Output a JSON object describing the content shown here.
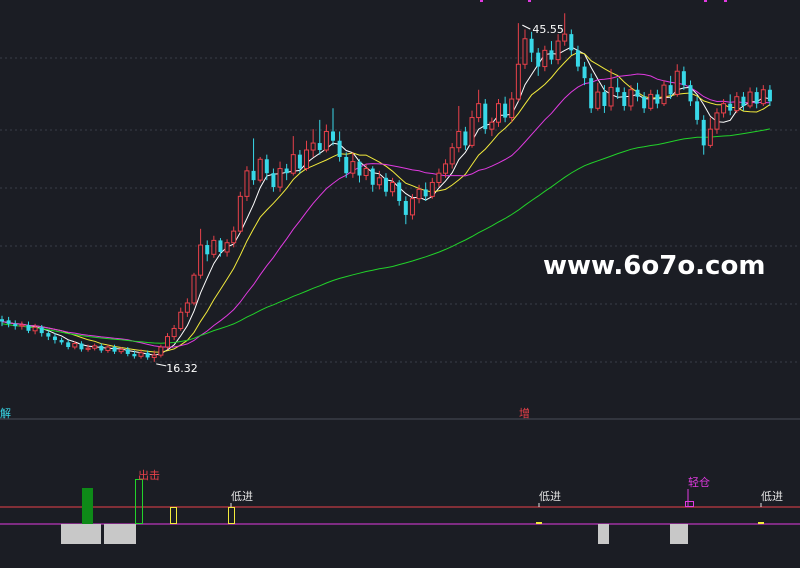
{
  "watermark": "www.6o7o.com",
  "chart_data": {
    "type": "candlestick",
    "colors": {
      "up": "#e8414a",
      "down": "#38d8e8",
      "background": "#1b1d24",
      "grid": "#3a3d48"
    },
    "annotations": {
      "high_label": "45.55",
      "low_label": "16.32",
      "high_value": 45.55,
      "low_value": 16.32
    },
    "price_range": [
      13.2,
      47.2
    ],
    "candles": [
      {
        "o": 20.0,
        "c": 19.8,
        "h": 20.3,
        "l": 19.4
      },
      {
        "o": 19.9,
        "c": 19.6,
        "h": 20.2,
        "l": 19.3
      },
      {
        "o": 19.6,
        "c": 19.4,
        "h": 19.9,
        "l": 19.1
      },
      {
        "o": 19.4,
        "c": 19.5,
        "h": 19.8,
        "l": 19.1
      },
      {
        "o": 19.5,
        "c": 19.0,
        "h": 19.8,
        "l": 18.8
      },
      {
        "o": 19.0,
        "c": 19.3,
        "h": 19.6,
        "l": 18.7
      },
      {
        "o": 19.3,
        "c": 18.8,
        "h": 19.5,
        "l": 18.5
      },
      {
        "o": 18.8,
        "c": 18.5,
        "h": 19.0,
        "l": 18.2
      },
      {
        "o": 18.5,
        "c": 18.2,
        "h": 18.8,
        "l": 17.9
      },
      {
        "o": 18.2,
        "c": 18.0,
        "h": 18.4,
        "l": 17.8
      },
      {
        "o": 18.0,
        "c": 17.6,
        "h": 18.2,
        "l": 17.4
      },
      {
        "o": 17.6,
        "c": 17.9,
        "h": 18.1,
        "l": 17.4
      },
      {
        "o": 17.9,
        "c": 17.4,
        "h": 18.1,
        "l": 17.2
      },
      {
        "o": 17.4,
        "c": 17.5,
        "h": 17.8,
        "l": 17.2
      },
      {
        "o": 17.5,
        "c": 17.7,
        "h": 17.9,
        "l": 17.3
      },
      {
        "o": 17.7,
        "c": 17.3,
        "h": 17.9,
        "l": 17.1
      },
      {
        "o": 17.3,
        "c": 17.6,
        "h": 17.8,
        "l": 17.1
      },
      {
        "o": 17.6,
        "c": 17.2,
        "h": 17.8,
        "l": 17.0
      },
      {
        "o": 17.2,
        "c": 17.4,
        "h": 17.6,
        "l": 17.0
      },
      {
        "o": 17.4,
        "c": 17.0,
        "h": 17.6,
        "l": 16.8
      },
      {
        "o": 17.0,
        "c": 16.8,
        "h": 17.3,
        "l": 16.6
      },
      {
        "o": 16.8,
        "c": 17.1,
        "h": 17.4,
        "l": 16.6
      },
      {
        "o": 17.1,
        "c": 16.7,
        "h": 17.3,
        "l": 16.5
      },
      {
        "o": 16.7,
        "c": 16.9,
        "h": 17.3,
        "l": 16.32
      },
      {
        "o": 16.9,
        "c": 17.6,
        "h": 17.8,
        "l": 16.7
      },
      {
        "o": 17.6,
        "c": 18.5,
        "h": 18.8,
        "l": 17.4
      },
      {
        "o": 18.5,
        "c": 19.2,
        "h": 19.5,
        "l": 18.2
      },
      {
        "o": 19.2,
        "c": 20.6,
        "h": 21.0,
        "l": 19.0
      },
      {
        "o": 20.6,
        "c": 21.4,
        "h": 21.8,
        "l": 20.2
      },
      {
        "o": 21.4,
        "c": 23.8,
        "h": 24.0,
        "l": 21.2
      },
      {
        "o": 23.8,
        "c": 26.4,
        "h": 27.8,
        "l": 23.5
      },
      {
        "o": 26.4,
        "c": 25.6,
        "h": 26.8,
        "l": 25.0
      },
      {
        "o": 25.6,
        "c": 26.8,
        "h": 27.2,
        "l": 25.3
      },
      {
        "o": 26.8,
        "c": 25.8,
        "h": 27.0,
        "l": 25.4
      },
      {
        "o": 25.8,
        "c": 26.6,
        "h": 26.9,
        "l": 25.4
      },
      {
        "o": 26.6,
        "c": 27.6,
        "h": 28.0,
        "l": 26.2
      },
      {
        "o": 27.6,
        "c": 30.6,
        "h": 31.0,
        "l": 27.4
      },
      {
        "o": 30.6,
        "c": 32.8,
        "h": 33.2,
        "l": 30.2
      },
      {
        "o": 32.8,
        "c": 32.0,
        "h": 35.6,
        "l": 31.6
      },
      {
        "o": 32.0,
        "c": 33.8,
        "h": 34.0,
        "l": 31.8
      },
      {
        "o": 33.8,
        "c": 32.6,
        "h": 34.2,
        "l": 32.0
      },
      {
        "o": 32.6,
        "c": 31.4,
        "h": 33.0,
        "l": 31.0
      },
      {
        "o": 31.4,
        "c": 33.0,
        "h": 33.6,
        "l": 31.0
      },
      {
        "o": 33.0,
        "c": 32.6,
        "h": 33.4,
        "l": 32.0
      },
      {
        "o": 32.6,
        "c": 34.2,
        "h": 35.8,
        "l": 32.4
      },
      {
        "o": 34.2,
        "c": 33.0,
        "h": 34.6,
        "l": 32.6
      },
      {
        "o": 33.0,
        "c": 34.6,
        "h": 35.4,
        "l": 32.8
      },
      {
        "o": 34.6,
        "c": 35.2,
        "h": 36.4,
        "l": 34.0
      },
      {
        "o": 35.2,
        "c": 34.6,
        "h": 37.2,
        "l": 34.2
      },
      {
        "o": 34.6,
        "c": 36.2,
        "h": 36.8,
        "l": 34.4
      },
      {
        "o": 36.2,
        "c": 35.4,
        "h": 38.2,
        "l": 35.0
      },
      {
        "o": 35.4,
        "c": 34.0,
        "h": 36.2,
        "l": 33.6
      },
      {
        "o": 34.0,
        "c": 32.6,
        "h": 34.4,
        "l": 32.2
      },
      {
        "o": 32.6,
        "c": 33.6,
        "h": 34.4,
        "l": 32.2
      },
      {
        "o": 33.6,
        "c": 32.4,
        "h": 33.8,
        "l": 31.8
      },
      {
        "o": 32.4,
        "c": 33.0,
        "h": 33.4,
        "l": 32.0
      },
      {
        "o": 33.0,
        "c": 31.6,
        "h": 33.2,
        "l": 31.0
      },
      {
        "o": 31.6,
        "c": 32.2,
        "h": 32.8,
        "l": 31.2
      },
      {
        "o": 32.2,
        "c": 31.0,
        "h": 32.6,
        "l": 30.6
      },
      {
        "o": 31.0,
        "c": 31.8,
        "h": 32.2,
        "l": 30.6
      },
      {
        "o": 31.8,
        "c": 30.2,
        "h": 32.0,
        "l": 29.8
      },
      {
        "o": 30.2,
        "c": 29.0,
        "h": 30.6,
        "l": 28.2
      },
      {
        "o": 29.0,
        "c": 30.4,
        "h": 30.8,
        "l": 28.6
      },
      {
        "o": 30.4,
        "c": 31.2,
        "h": 31.6,
        "l": 30.0
      },
      {
        "o": 31.2,
        "c": 30.6,
        "h": 31.8,
        "l": 30.2
      },
      {
        "o": 30.6,
        "c": 31.8,
        "h": 32.2,
        "l": 30.4
      },
      {
        "o": 31.8,
        "c": 32.6,
        "h": 33.0,
        "l": 31.4
      },
      {
        "o": 32.6,
        "c": 33.4,
        "h": 33.8,
        "l": 32.2
      },
      {
        "o": 33.4,
        "c": 34.8,
        "h": 35.2,
        "l": 33.0
      },
      {
        "o": 34.8,
        "c": 36.2,
        "h": 38.4,
        "l": 34.4
      },
      {
        "o": 36.2,
        "c": 35.0,
        "h": 36.6,
        "l": 34.6
      },
      {
        "o": 35.0,
        "c": 37.4,
        "h": 38.0,
        "l": 34.8
      },
      {
        "o": 37.4,
        "c": 38.6,
        "h": 39.8,
        "l": 37.0
      },
      {
        "o": 38.6,
        "c": 36.4,
        "h": 39.0,
        "l": 36.0
      },
      {
        "o": 36.4,
        "c": 37.0,
        "h": 37.4,
        "l": 35.8
      },
      {
        "o": 37.0,
        "c": 38.6,
        "h": 39.0,
        "l": 36.6
      },
      {
        "o": 38.6,
        "c": 37.4,
        "h": 39.2,
        "l": 37.0
      },
      {
        "o": 37.4,
        "c": 39.0,
        "h": 39.6,
        "l": 37.0
      },
      {
        "o": 39.0,
        "c": 42.0,
        "h": 45.55,
        "l": 38.8
      },
      {
        "o": 42.0,
        "c": 44.2,
        "h": 45.0,
        "l": 41.6
      },
      {
        "o": 44.2,
        "c": 43.0,
        "h": 44.8,
        "l": 42.2
      },
      {
        "o": 43.0,
        "c": 41.8,
        "h": 43.4,
        "l": 41.0
      },
      {
        "o": 41.8,
        "c": 43.2,
        "h": 43.6,
        "l": 41.4
      },
      {
        "o": 43.2,
        "c": 42.4,
        "h": 44.0,
        "l": 42.0
      },
      {
        "o": 42.4,
        "c": 44.0,
        "h": 44.6,
        "l": 42.0
      },
      {
        "o": 44.0,
        "c": 44.6,
        "h": 46.4,
        "l": 43.6
      },
      {
        "o": 44.6,
        "c": 43.2,
        "h": 45.0,
        "l": 42.8
      },
      {
        "o": 43.2,
        "c": 41.8,
        "h": 43.6,
        "l": 41.4
      },
      {
        "o": 41.8,
        "c": 40.8,
        "h": 42.2,
        "l": 40.2
      },
      {
        "o": 40.8,
        "c": 38.2,
        "h": 41.2,
        "l": 37.8
      },
      {
        "o": 38.2,
        "c": 39.6,
        "h": 40.4,
        "l": 38.0
      },
      {
        "o": 39.6,
        "c": 38.4,
        "h": 40.2,
        "l": 37.8
      },
      {
        "o": 38.4,
        "c": 40.0,
        "h": 41.6,
        "l": 38.0
      },
      {
        "o": 40.0,
        "c": 39.6,
        "h": 40.8,
        "l": 39.0
      },
      {
        "o": 39.6,
        "c": 38.4,
        "h": 40.0,
        "l": 38.0
      },
      {
        "o": 38.4,
        "c": 39.8,
        "h": 40.2,
        "l": 38.0
      },
      {
        "o": 39.8,
        "c": 39.2,
        "h": 40.4,
        "l": 38.8
      },
      {
        "o": 39.2,
        "c": 38.2,
        "h": 39.6,
        "l": 37.8
      },
      {
        "o": 38.2,
        "c": 39.4,
        "h": 39.8,
        "l": 38.0
      },
      {
        "o": 39.4,
        "c": 38.6,
        "h": 39.8,
        "l": 38.2
      },
      {
        "o": 38.6,
        "c": 40.2,
        "h": 40.6,
        "l": 38.4
      },
      {
        "o": 40.2,
        "c": 39.4,
        "h": 41.0,
        "l": 39.0
      },
      {
        "o": 39.4,
        "c": 41.4,
        "h": 42.0,
        "l": 39.2
      },
      {
        "o": 41.4,
        "c": 40.2,
        "h": 41.8,
        "l": 39.8
      },
      {
        "o": 40.2,
        "c": 38.8,
        "h": 40.6,
        "l": 38.4
      },
      {
        "o": 38.8,
        "c": 37.2,
        "h": 39.2,
        "l": 36.8
      },
      {
        "o": 37.2,
        "c": 35.0,
        "h": 37.6,
        "l": 34.2
      },
      {
        "o": 35.0,
        "c": 36.4,
        "h": 37.4,
        "l": 34.8
      },
      {
        "o": 36.4,
        "c": 37.8,
        "h": 38.2,
        "l": 36.0
      },
      {
        "o": 37.8,
        "c": 38.6,
        "h": 39.0,
        "l": 37.4
      },
      {
        "o": 38.6,
        "c": 38.0,
        "h": 39.4,
        "l": 37.6
      },
      {
        "o": 38.0,
        "c": 39.2,
        "h": 39.6,
        "l": 37.8
      },
      {
        "o": 39.2,
        "c": 38.4,
        "h": 39.6,
        "l": 38.0
      },
      {
        "o": 38.4,
        "c": 39.6,
        "h": 40.0,
        "l": 38.2
      },
      {
        "o": 39.6,
        "c": 38.6,
        "h": 40.0,
        "l": 38.2
      },
      {
        "o": 38.6,
        "c": 39.8,
        "h": 40.2,
        "l": 38.4
      },
      {
        "o": 39.8,
        "c": 38.8,
        "h": 40.2,
        "l": 38.4
      }
    ],
    "moving_averages": [
      {
        "name": "MA5",
        "color": "#ffffff",
        "period": 5
      },
      {
        "name": "MA10",
        "color": "#f2ea3c",
        "period": 10
      },
      {
        "name": "MA20",
        "color": "#e03ae0",
        "period": 20
      },
      {
        "name": "MA60",
        "color": "#22d22a",
        "period": 60
      }
    ],
    "upper_panel_labels": [
      {
        "text": "解",
        "color": "#38d8e8",
        "bar": 0
      },
      {
        "text": "增",
        "color": "#e8414a",
        "bar": 79
      }
    ],
    "indicator": {
      "labels": [
        {
          "text": "出击",
          "color": "#e8414a"
        },
        {
          "text": "低进",
          "color": "#e0e0e0"
        },
        {
          "text": "低进",
          "color": "#e0e0e0"
        },
        {
          "text": "轻仓",
          "color": "#e03ae0"
        },
        {
          "text": "低进",
          "color": "#e0e0e0"
        }
      ]
    }
  }
}
